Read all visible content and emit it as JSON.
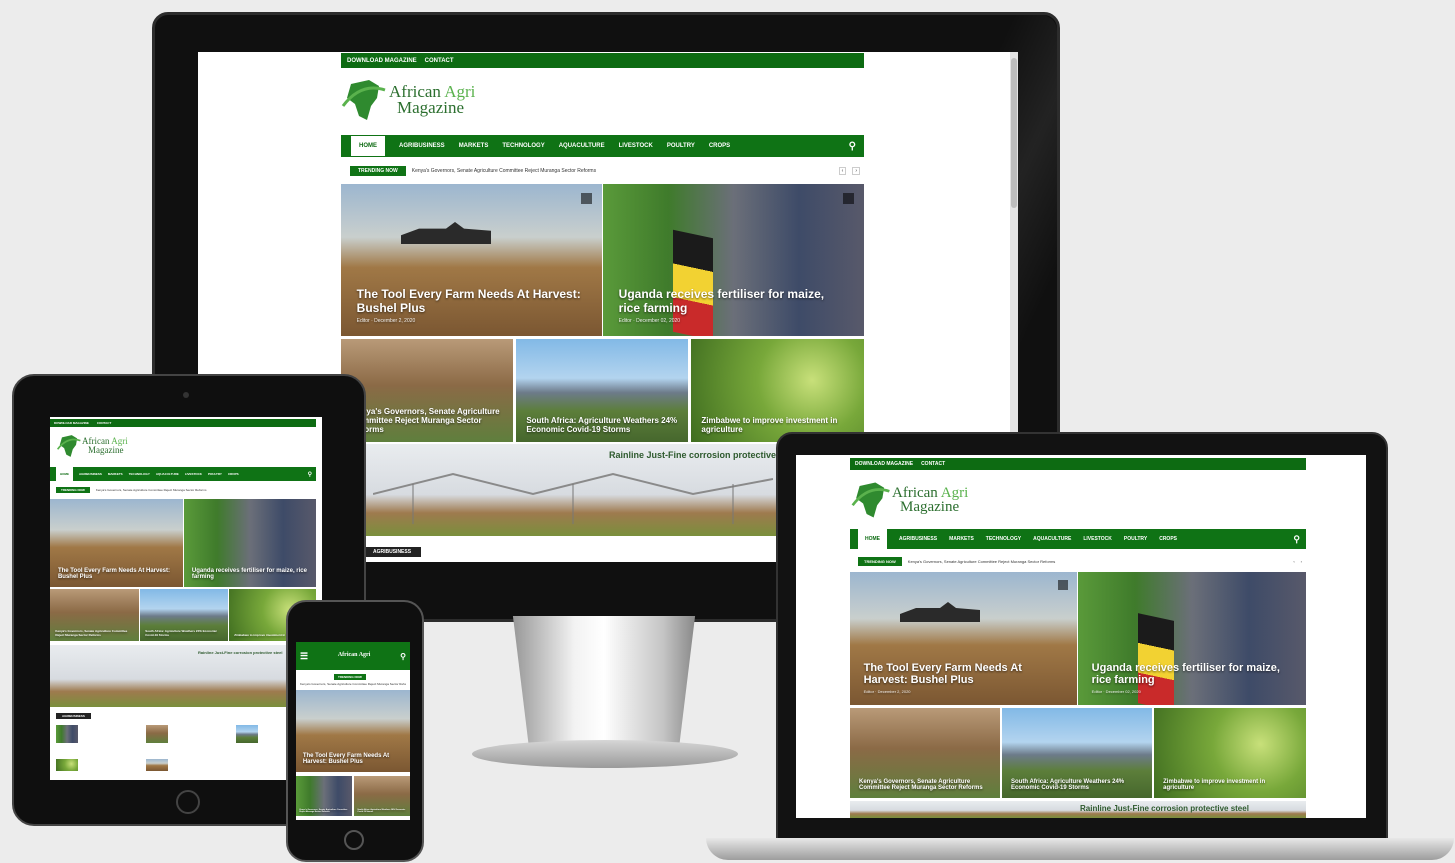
{
  "site": {
    "topbar": {
      "links": [
        "DOWNLOAD MAGAZINE",
        "CONTACT"
      ]
    },
    "logo": {
      "line1": "African",
      "line2": "Agri",
      "line3": "Magazine"
    },
    "nav": [
      "HOME",
      "AGRIBUSINESS",
      "MARKETS",
      "TECHNOLOGY",
      "AQUACULTURE",
      "LIVESTOCK",
      "POULTRY",
      "CROPS"
    ],
    "trending": {
      "badge": "TRENDING NOW",
      "headline": "Kenya's Governors, Senate Agriculture Committee Reject Muranga Sector Reforms"
    },
    "featured": [
      {
        "title": "The Tool Every Farm Needs At Harvest: Bushel Plus",
        "meta": "Editor · December 2, 2020"
      },
      {
        "title": "Uganda receives fertiliser for maize, rice farming",
        "meta": "Editor · December 02, 2020"
      }
    ],
    "row": [
      {
        "title": "Kenya's Governors, Senate Agriculture Committee Reject Muranga Sector Reforms"
      },
      {
        "title": "South Africa: Agriculture Weathers 24% Economic Covid-19 Storms"
      },
      {
        "title": "Zimbabwe to improve investment in agriculture"
      }
    ],
    "banner": {
      "text": "Rainline Just-Fine corrosion protective steel"
    },
    "section_badge": "AGRIBUSINESS"
  },
  "colors": {
    "primary": "#0f7315",
    "topbar": "#0d6b12",
    "logo_accent": "#5ab24d"
  },
  "icons": [
    "search-icon",
    "bookmark-icon",
    "chevron-left-icon",
    "chevron-right-icon",
    "hamburger-icon",
    "home-button-icon",
    "camera-icon"
  ]
}
